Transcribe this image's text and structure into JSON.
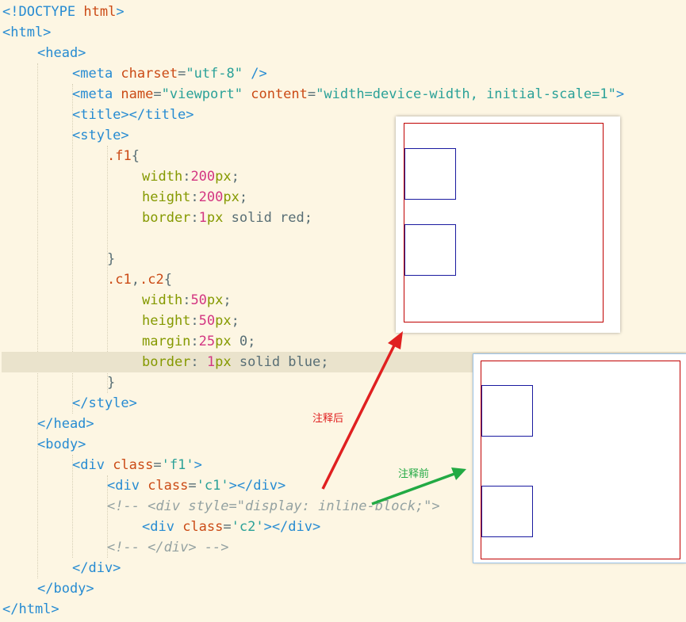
{
  "code": {
    "l1": {
      "a": "<!DOCTYPE ",
      "b": "html",
      "c": ">"
    },
    "l2": {
      "a": "<html>"
    },
    "l3": {
      "a": "<head>"
    },
    "l4": {
      "a": "<meta ",
      "b": "charset",
      "c": "=",
      "d": "\"utf-8\"",
      "e": " />"
    },
    "l5": {
      "a": "<meta ",
      "b": "name",
      "c": "=",
      "d": "\"viewport\"",
      "e": " ",
      "f": "content",
      "g": "=",
      "h": "\"width=device-width, initial-scale=1\"",
      "i": ">"
    },
    "l6": {
      "a": "<title></title>"
    },
    "l7": {
      "a": "<style>"
    },
    "l8": {
      "a": ".f1",
      "b": "{"
    },
    "l9": {
      "a": "width",
      "b": ":",
      "c": "200",
      "d": "px",
      ";": ";"
    },
    "l10": {
      "a": "height",
      "b": ":",
      "c": "200",
      "d": "px",
      "e": ";"
    },
    "l11": {
      "a": "border",
      "b": ":",
      "c": "1",
      "d": "px",
      "e": " solid red;"
    },
    "l12": {
      "a": "}"
    },
    "l13": {
      "a": ".c1",
      ",": ",",
      "b": ".c2",
      "c": "{"
    },
    "l14": {
      "a": "width",
      "b": ":",
      "c": "50",
      "d": "px",
      "e": ";"
    },
    "l15": {
      "a": "height",
      "b": ":",
      "c": "50",
      "d": "px",
      "e": ";"
    },
    "l16": {
      "a": "margin",
      "b": ":",
      "c": "25",
      "d": "px",
      "e": " 0;"
    },
    "l17": {
      "a": "border",
      "b": ": ",
      "c": "1",
      "d": "px",
      "e": " solid blue;"
    },
    "l18": {
      "a": "}"
    },
    "l19": {
      "a": "</style>"
    },
    "l20": {
      "a": "</head>"
    },
    "l21": {
      "a": "<body>"
    },
    "l22": {
      "a": "<div ",
      "b": "class",
      "c": "=",
      "d": "'f1'",
      "e": ">"
    },
    "l23": {
      "a": "<div ",
      "b": "class",
      "c": "=",
      "d": "'c1'",
      "e": "></div>"
    },
    "l24": {
      "a": "<!-- <div style=\"display: inline-block;\">"
    },
    "l25": {
      "a": "<div ",
      "b": "class",
      "c": "=",
      "d": "'c2'",
      "e": "></div>"
    },
    "l26": {
      "a": "<!-- </div> -->"
    },
    "l27": {
      "a": "</div>"
    },
    "l28": {
      "a": "</body>"
    },
    "l29": {
      "a": "</html>"
    }
  },
  "annotations": {
    "after_label": "注释后",
    "before_label": "注释前"
  },
  "colors": {
    "background": "#fdf6e3",
    "current_line": "#eae3cc",
    "arrow_red": "#e02020",
    "arrow_green": "#22aa44",
    "box_red": "#c00000",
    "box_blue": "#1a1aa0"
  }
}
